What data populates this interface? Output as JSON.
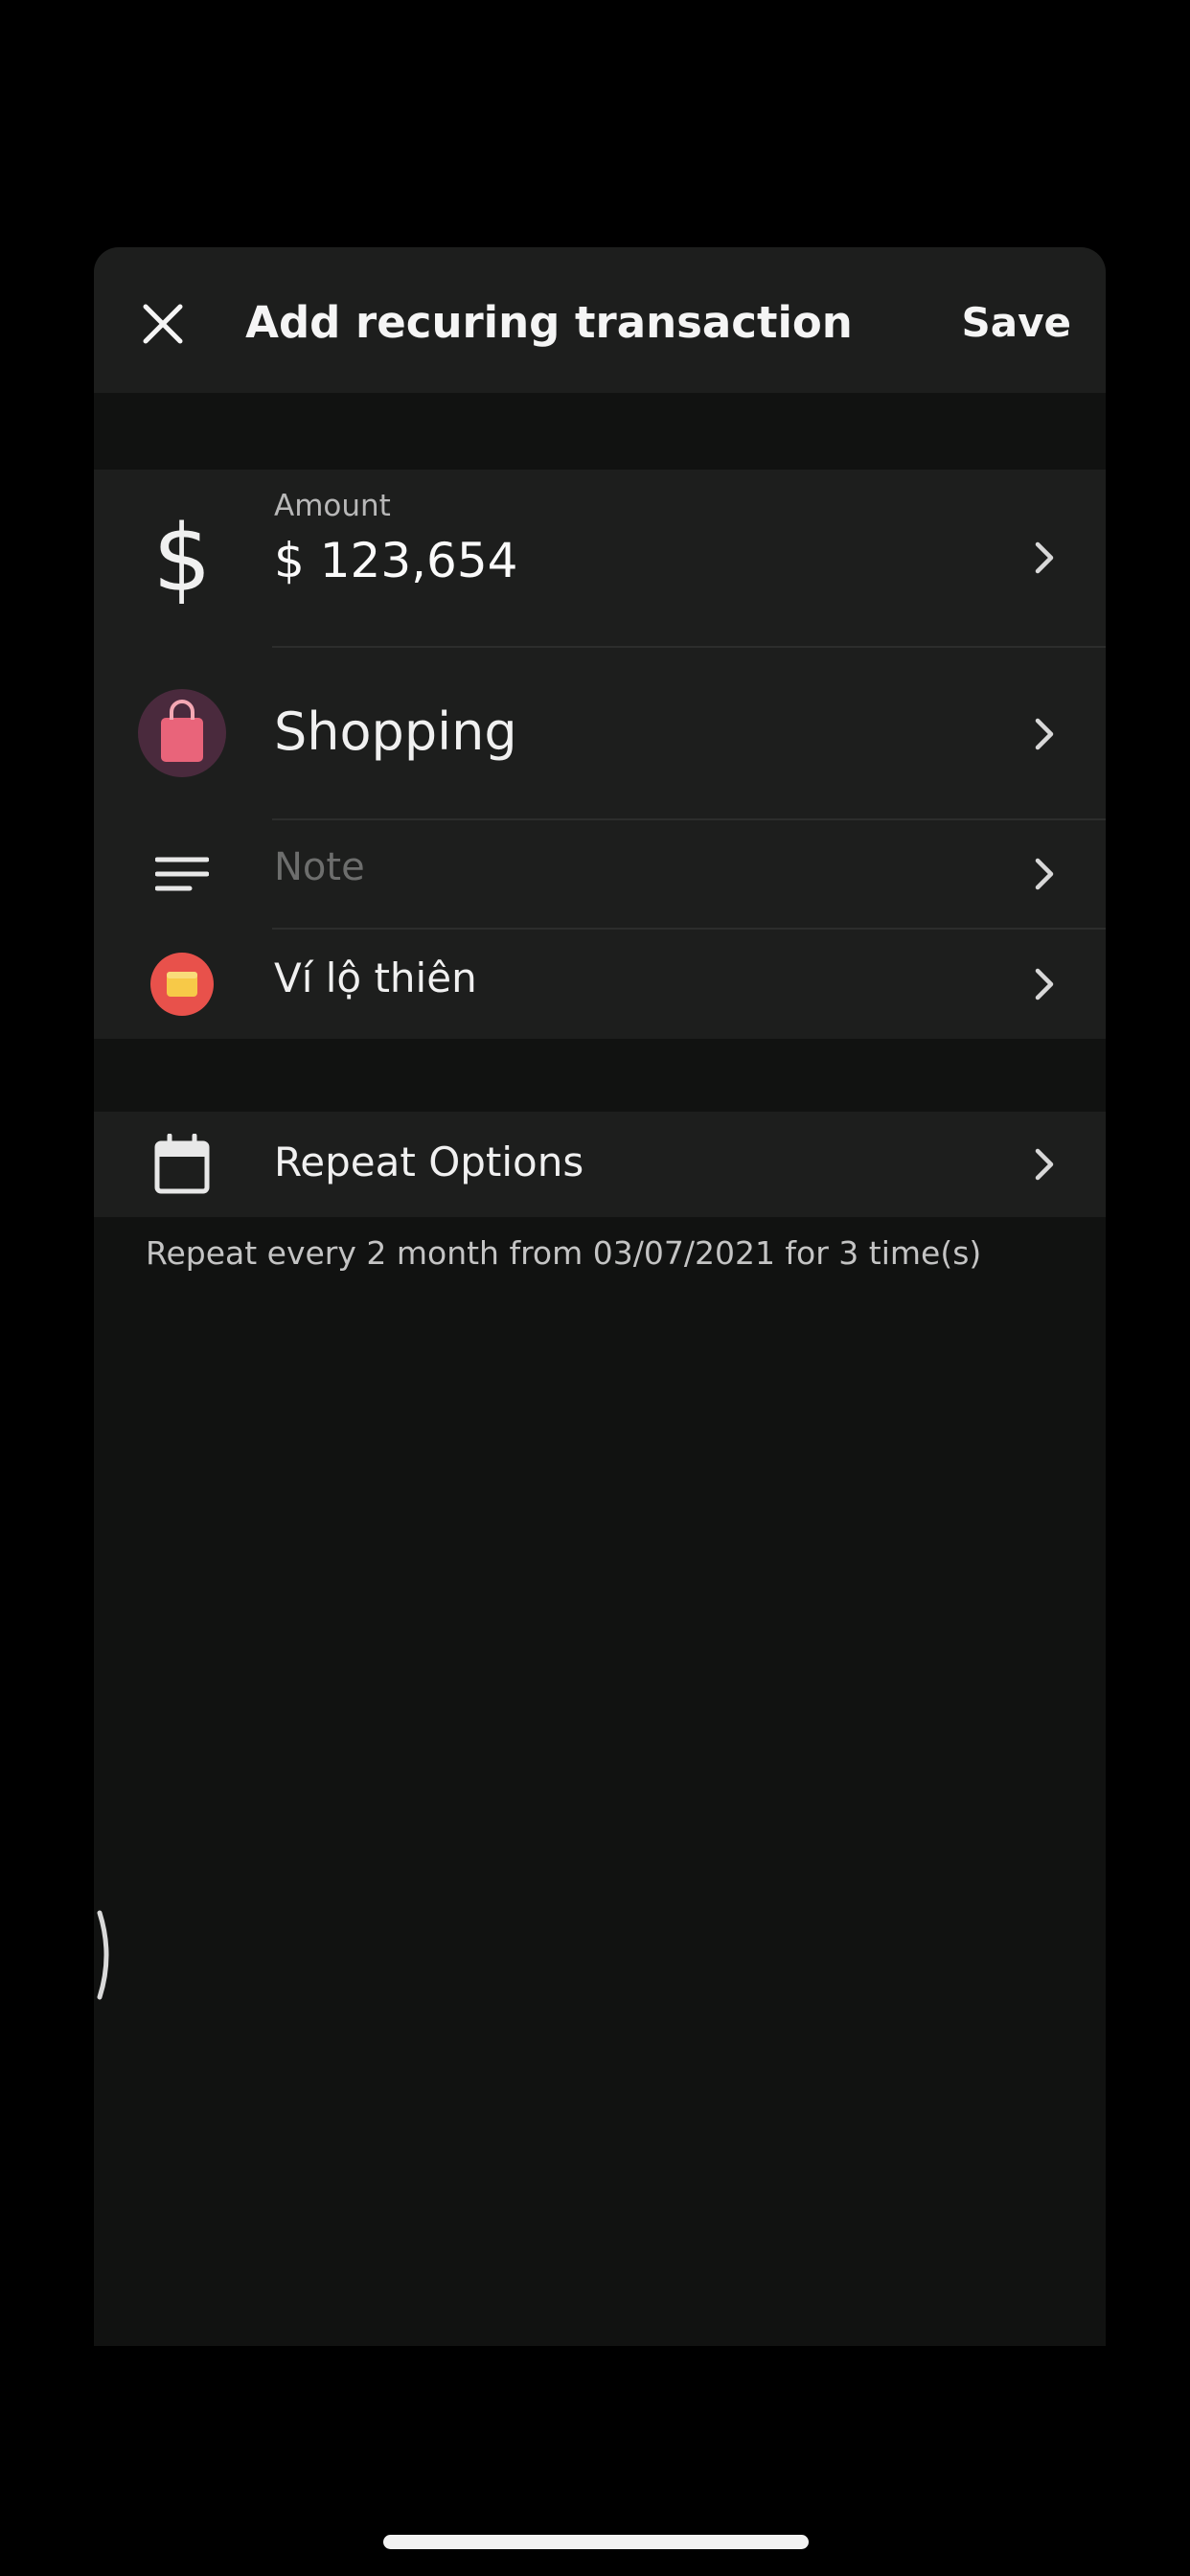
{
  "header": {
    "title": "Add recuring transaction",
    "save_label": "Save",
    "close_icon": "close-icon"
  },
  "transaction": {
    "amount_label": "Amount",
    "amount_value": "$ 123,654",
    "amount_icon": "dollar-icon",
    "category_label": "Shopping",
    "category_icon": "shopping-bag-icon",
    "note_placeholder": "Note",
    "note_icon": "note-lines-icon",
    "wallet_label": "Ví lộ thiên",
    "wallet_icon": "wallet-icon"
  },
  "repeat": {
    "label": "Repeat Options",
    "icon": "calendar-icon",
    "summary": "Repeat every 2 month from 03/07/2021 for 3 time(s)"
  },
  "colors": {
    "background": "#000000",
    "sheet": "#111211",
    "row_background": "#1d1e1d",
    "category_accent": "#e05a6a",
    "wallet_accent": "#e8514b",
    "wallet_inner": "#f7c948"
  }
}
